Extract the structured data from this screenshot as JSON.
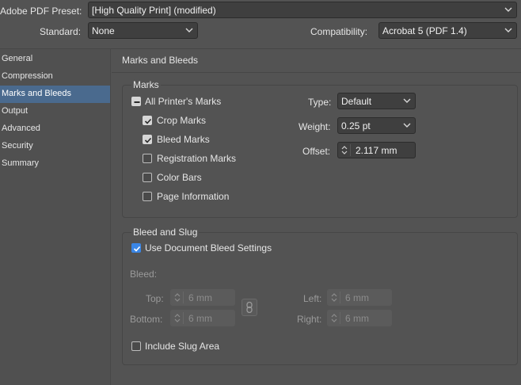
{
  "top": {
    "preset_label": "Adobe PDF Preset:",
    "preset_value": "[High Quality Print] (modified)",
    "standard_label": "Standard:",
    "standard_value": "None",
    "compat_label": "Compatibility:",
    "compat_value": "Acrobat 5 (PDF 1.4)"
  },
  "sidebar": {
    "items": [
      {
        "label": "General"
      },
      {
        "label": "Compression"
      },
      {
        "label": "Marks and Bleeds"
      },
      {
        "label": "Output"
      },
      {
        "label": "Advanced"
      },
      {
        "label": "Security"
      },
      {
        "label": "Summary"
      }
    ],
    "active_index": 2
  },
  "main": {
    "title": "Marks and Bleeds",
    "marks": {
      "group_title": "Marks",
      "all_printers_marks": "All Printer's Marks",
      "crop_marks": "Crop Marks",
      "bleed_marks": "Bleed Marks",
      "registration_marks": "Registration Marks",
      "color_bars": "Color Bars",
      "page_information": "Page Information",
      "type_label": "Type:",
      "type_value": "Default",
      "weight_label": "Weight:",
      "weight_value": "0.25 pt",
      "offset_label": "Offset:",
      "offset_value": "2.117 mm"
    },
    "bleed": {
      "group_title": "Bleed and Slug",
      "use_doc_bleed": "Use Document Bleed Settings",
      "bleed_label": "Bleed:",
      "top_label": "Top:",
      "top_value": "6 mm",
      "bottom_label": "Bottom:",
      "bottom_value": "6 mm",
      "left_label": "Left:",
      "left_value": "6 mm",
      "right_label": "Right:",
      "right_value": "6 mm",
      "include_slug": "Include Slug Area"
    }
  }
}
